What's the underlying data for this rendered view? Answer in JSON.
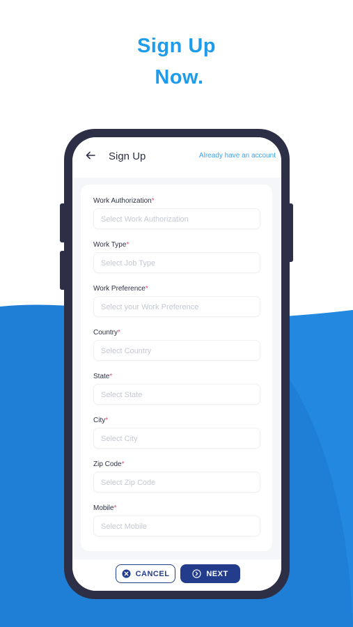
{
  "hero": {
    "line1": "Sign Up",
    "line2": "Now."
  },
  "colors": {
    "accent": "#1e9be9",
    "primary": "#233d8c",
    "background_blue": "#1f7fd6",
    "required": "#e0506e"
  },
  "header": {
    "back_icon": "arrow-left-icon",
    "title": "Sign Up",
    "link": "Already have an account"
  },
  "form": {
    "fields": [
      {
        "label": "Work Authorization",
        "required": "*",
        "placeholder": "Select Work Authorization"
      },
      {
        "label": "Work Type",
        "required": "*",
        "placeholder": "Select Job Type"
      },
      {
        "label": "Work Preference",
        "required": "*",
        "placeholder": "Select your Work Preference"
      },
      {
        "label": "Country",
        "required": "*",
        "placeholder": "Select Country"
      },
      {
        "label": "State",
        "required": "*",
        "placeholder": "Select State"
      },
      {
        "label": "City",
        "required": "*",
        "placeholder": "Select City"
      },
      {
        "label": "Zip Code",
        "required": "*",
        "placeholder": "Select Zip Code"
      },
      {
        "label": "Mobile",
        "required": "*",
        "placeholder": "Select Mobile"
      }
    ]
  },
  "footer": {
    "cancel_label": "CANCEL",
    "cancel_icon": "close-circle-icon",
    "next_label": "NEXT",
    "next_icon": "chevron-right-circle-icon"
  }
}
